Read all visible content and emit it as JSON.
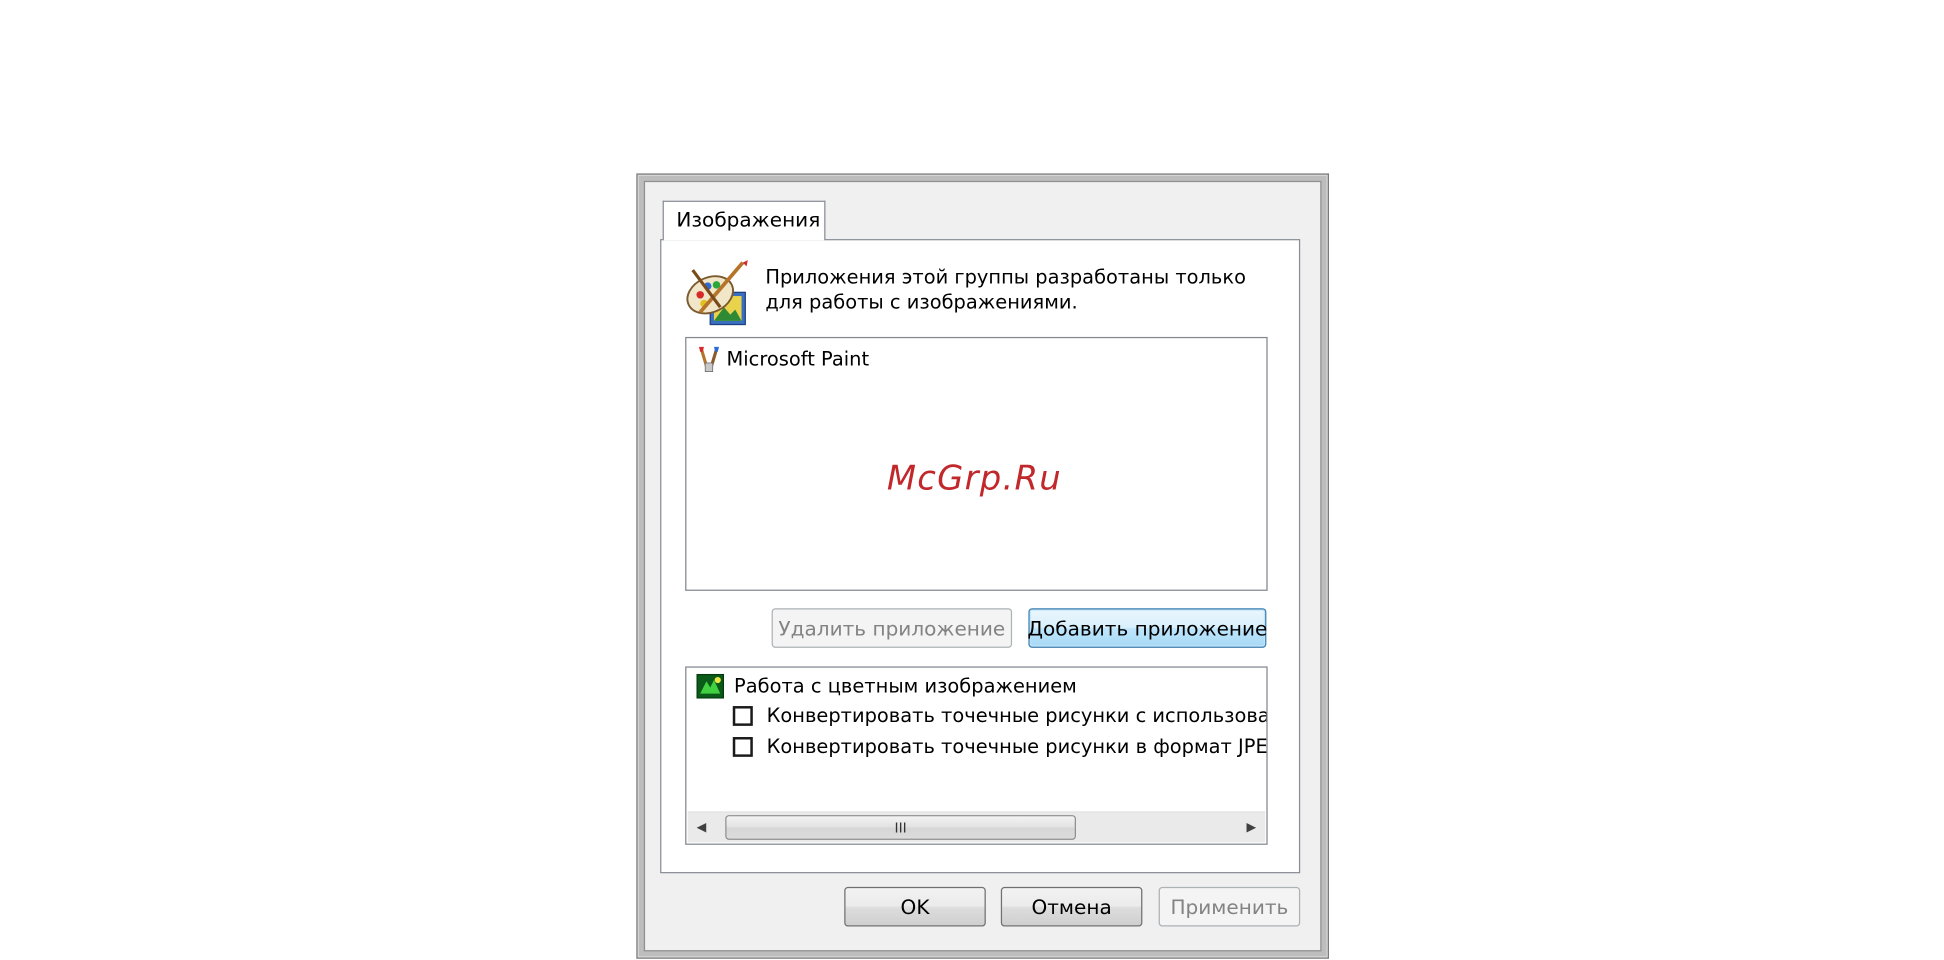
{
  "tab": {
    "label": "Изображения"
  },
  "description": {
    "line1": "Приложения этой группы разработаны только",
    "line2": "для работы с изображениями."
  },
  "app_list": {
    "items": [
      {
        "label": "Microsoft Paint",
        "icon": "paint-brushes-icon"
      }
    ]
  },
  "watermark": "McGrp.Ru",
  "buttons": {
    "remove_app": "Удалить приложение",
    "add_app": "Добавить приложение",
    "ok": "OK",
    "cancel": "Отмена",
    "apply": "Применить"
  },
  "options": {
    "group_label": "Работа с цветным изображением",
    "group_icon": "color-image-icon",
    "items": [
      {
        "label": "Конвертировать точечные рисунки с использован",
        "checked": false
      },
      {
        "label": "Конвертировать точечные рисунки в формат JPE(",
        "checked": false
      }
    ]
  },
  "scrollbar": {
    "thumb_grip": "III"
  },
  "colors": {
    "dialog_bg": "#f0f0f0",
    "watermark": "#c0282b",
    "focus_border": "#3c7fb1"
  }
}
